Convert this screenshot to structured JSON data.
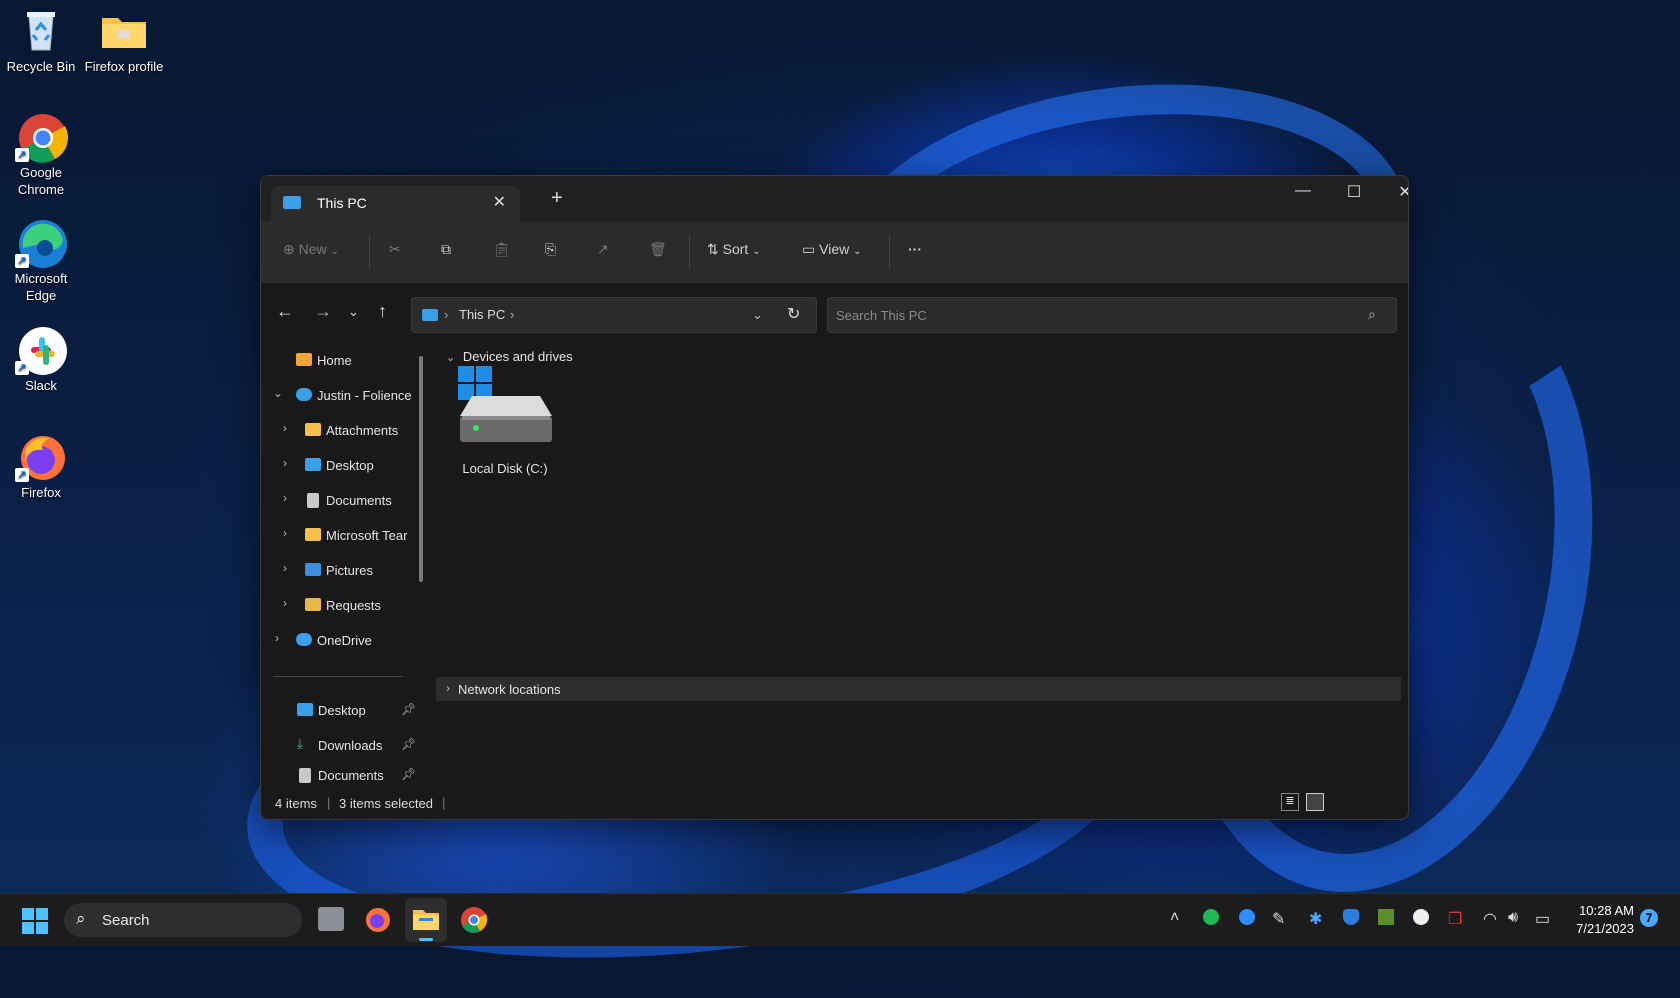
{
  "desktop": {
    "icons": [
      {
        "label": "Recycle Bin"
      },
      {
        "label": "Firefox profile"
      },
      {
        "label": "Google Chrome"
      },
      {
        "label": "Microsoft Edge"
      },
      {
        "label": "Slack"
      },
      {
        "label": "Firefox"
      }
    ]
  },
  "window": {
    "tab_title": "This PC",
    "new_tab": "+",
    "toolbar": {
      "new_label": "New",
      "sort_label": "Sort",
      "view_label": "View",
      "more_label": "···"
    },
    "address": {
      "crumb": "This PC"
    },
    "search": {
      "placeholder": "Search This PC"
    },
    "sidebar": {
      "home": "Home",
      "account": "Justin - Folience",
      "folders": [
        "Attachments",
        "Desktop",
        "Documents",
        "Microsoft Tear",
        "Pictures",
        "Requests"
      ],
      "onedrive": "OneDrive",
      "pinned": [
        "Desktop",
        "Downloads",
        "Documents"
      ]
    },
    "content": {
      "group_devices": "Devices and drives",
      "drive_label": "Local Disk (C:)",
      "group_network": "Network locations"
    },
    "status": {
      "items": "4 items",
      "selected": "3 items selected"
    }
  },
  "taskbar": {
    "search_placeholder": "Search",
    "time": "10:28 AM",
    "date": "7/21/2023",
    "notification_count": "7"
  },
  "colors": {
    "accent": "#3aa0e8",
    "folder": "#f5c14a"
  }
}
